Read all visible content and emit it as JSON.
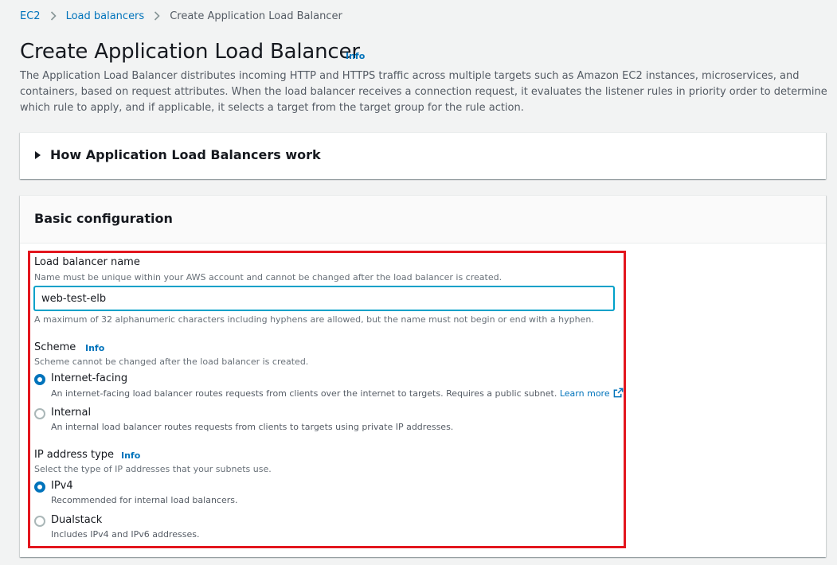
{
  "breadcrumb": {
    "items": [
      "EC2",
      "Load balancers"
    ],
    "current": "Create Application Load Balancer"
  },
  "header": {
    "title": "Create Application Load Balancer",
    "info": "Info",
    "description": "The Application Load Balancer distributes incoming HTTP and HTTPS traffic across multiple targets such as Amazon EC2 instances, microservices, and containers, based on request attributes. When the load balancer receives a connection request, it evaluates the listener rules in priority order to determine which rule to apply, and if applicable, it selects a target from the target group for the rule action."
  },
  "how_it_works": {
    "title": "How Application Load Balancers work"
  },
  "basic_config": {
    "title": "Basic configuration",
    "name_field": {
      "label": "Load balancer name",
      "hint": "Name must be unique within your AWS account and cannot be changed after the load balancer is created.",
      "value": "web-test-elb",
      "constraint": "A maximum of 32 alphanumeric characters including hyphens are allowed, but the name must not begin or end with a hyphen."
    },
    "scheme": {
      "label": "Scheme",
      "info": "Info",
      "hint": "Scheme cannot be changed after the load balancer is created.",
      "options": [
        {
          "label": "Internet-facing",
          "desc": "An internet-facing load balancer routes requests from clients over the internet to targets. Requires a public subnet.",
          "link": "Learn more",
          "checked": true
        },
        {
          "label": "Internal",
          "desc": "An internal load balancer routes requests from clients to targets using private IP addresses.",
          "checked": false
        }
      ]
    },
    "ip_type": {
      "label": "IP address type",
      "info": "Info",
      "hint": "Select the type of IP addresses that your subnets use.",
      "options": [
        {
          "label": "IPv4",
          "desc": "Recommended for internal load balancers.",
          "checked": true
        },
        {
          "label": "Dualstack",
          "desc": "Includes IPv4 and IPv6 addresses.",
          "checked": false
        }
      ]
    }
  },
  "colors": {
    "link": "#0073bb",
    "highlight": "#e3161e",
    "focus": "#00a1c9"
  },
  "icons": [
    "chevron-right-icon",
    "caret-right-icon",
    "external-link-icon"
  ]
}
